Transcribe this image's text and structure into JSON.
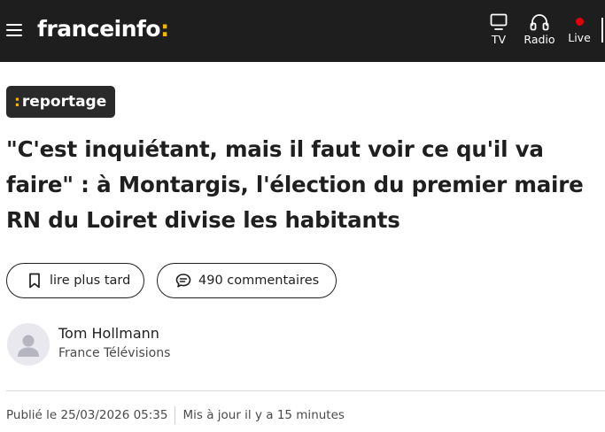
{
  "header": {
    "logo_text": "franceinfo",
    "logo_colon": ":",
    "nav": [
      {
        "label": "TV",
        "icon": "tv-icon"
      },
      {
        "label": "Radio",
        "icon": "headphones-icon"
      },
      {
        "label": "Live",
        "icon": "live-dot-icon"
      }
    ]
  },
  "article": {
    "tag_colon": ":",
    "tag_label": "reportage",
    "title": "\"C'est inquiétant, mais il faut voir ce qu'il va faire\" : à Montargis, l'élection du premier maire RN du Loiret divise les habitants",
    "save_label": "lire plus tard",
    "comments_label": "490 commentaires",
    "author_name": "Tom Hollmann",
    "author_org": "France Télévisions",
    "published": "Publié le 25/03/2026 05:35",
    "updated": "Mis à jour il y a 15 minutes"
  },
  "colors": {
    "header_bg": "#1e1e1e",
    "brand_yellow": "#f5b700",
    "live_red": "#e3000b",
    "tag_bg": "#2a2a2a"
  }
}
